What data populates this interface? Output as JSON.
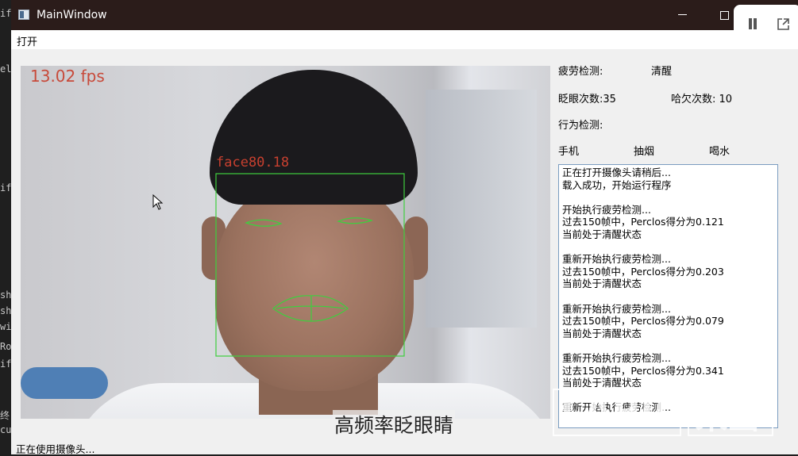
{
  "window": {
    "title": "MainWindow"
  },
  "menu": {
    "open": "打开"
  },
  "camera": {
    "fps_text": "13.02 fps",
    "face_label": "face80.18"
  },
  "subtitle": "高频率眨眼睛",
  "status": {
    "fatigue_label": "疲劳检测:",
    "fatigue_value": "清醒",
    "blink_label": "眨眼次数:35",
    "yawn_label": "哈欠次数: 10",
    "behavior_label": "行为检测:",
    "behaviors": [
      "手机",
      "抽烟",
      "喝水"
    ]
  },
  "log": [
    "正在打开摄像头请稍后...",
    "载入成功，开始运行程序",
    "",
    "开始执行疲劳检测...",
    "过去150帧中，Perclos得分为0.121",
    "当前处于清醒状态",
    "",
    "重新开始执行疲劳检测...",
    "过去150帧中，Perclos得分为0.203",
    "当前处于清醒状态",
    "",
    "重新开始执行疲劳检测...",
    "过去150帧中，Perclos得分为0.079",
    "当前处于清醒状态",
    "",
    "重新开始执行疲劳检测...",
    "过去150帧中，Perclos得分为0.341",
    "当前处于清醒状态",
    "",
    "重新开始执行疲劳检测..."
  ],
  "statusbar": {
    "text": "正在使用摄像头..."
  },
  "watermark": {
    "left": "LAPIC",
    "right": "来画"
  },
  "colors": {
    "titlebar": "#2b1c1a",
    "landmarks": "#3ecf3e",
    "overlay_text": "#c8402f",
    "log_border": "#7a9cc0"
  }
}
